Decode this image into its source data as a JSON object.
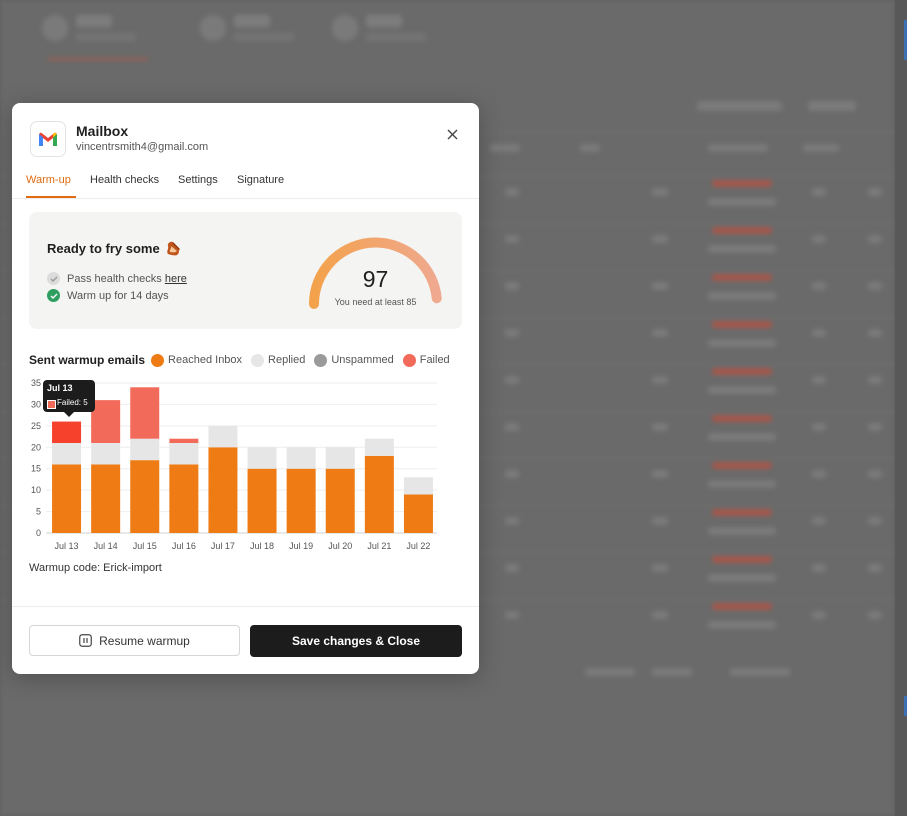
{
  "modal": {
    "title": "Mailbox",
    "email": "vincentrsmith4@gmail.com",
    "tabs": [
      {
        "label": "Warm-up",
        "active": true
      },
      {
        "label": "Health checks",
        "active": false
      },
      {
        "label": "Settings",
        "active": false
      },
      {
        "label": "Signature",
        "active": false
      }
    ],
    "icons": {
      "logo": "gmail-logo-icon",
      "close": "close-icon",
      "bacon": "bacon-emoji",
      "pause": "pause-icon"
    }
  },
  "readiness": {
    "title": "Ready to fry some",
    "emoji": "🥓",
    "checks": [
      {
        "text": "Pass health checks ",
        "link": "here",
        "done": false
      },
      {
        "text": "Warm up for 14 days",
        "done": true
      }
    ],
    "score": "97",
    "score_note": "You need at least 85",
    "score_value": 97,
    "score_max": 100
  },
  "chart_section": {
    "title": "Sent warmup emails",
    "legend": [
      {
        "label": "Reached Inbox",
        "color": "#ee7b14"
      },
      {
        "label": "Replied",
        "color": "#e6e6e6"
      },
      {
        "label": "Unspammed",
        "color": "#9a9a9a"
      },
      {
        "label": "Failed",
        "color": "#f26a5a"
      }
    ],
    "tooltip": {
      "date": "Jul 13",
      "label": "Failed: 5"
    }
  },
  "chart_data": {
    "type": "bar",
    "stacked": true,
    "categories": [
      "Jul 13",
      "Jul 14",
      "Jul 15",
      "Jul 16",
      "Jul 17",
      "Jul 18",
      "Jul 19",
      "Jul 20",
      "Jul 21",
      "Jul 22"
    ],
    "series": [
      {
        "name": "Reached Inbox",
        "color": "#ee7b14",
        "values": [
          16,
          16,
          17,
          16,
          20,
          15,
          15,
          15,
          18,
          9
        ]
      },
      {
        "name": "Replied",
        "color": "#e6e6e6",
        "values": [
          5,
          5,
          5,
          5,
          5,
          5,
          5,
          5,
          4,
          4
        ]
      },
      {
        "name": "Unspammed",
        "color": "#9a9a9a",
        "values": [
          0,
          0,
          0,
          0,
          0,
          0,
          0,
          0,
          0,
          0
        ]
      },
      {
        "name": "Failed",
        "color": "#f26a5a",
        "values": [
          5,
          10,
          12,
          1,
          0,
          0,
          0,
          0,
          0,
          0
        ]
      }
    ],
    "yticks": [
      0,
      5,
      10,
      15,
      20,
      25,
      30,
      35
    ],
    "ylim": [
      0,
      35
    ],
    "grid": true,
    "legend_position": "top"
  },
  "warmup_code_label": "Warmup code: Erick-import",
  "footer": {
    "resume_label": "Resume warmup",
    "save_label": "Save changes & Close"
  }
}
